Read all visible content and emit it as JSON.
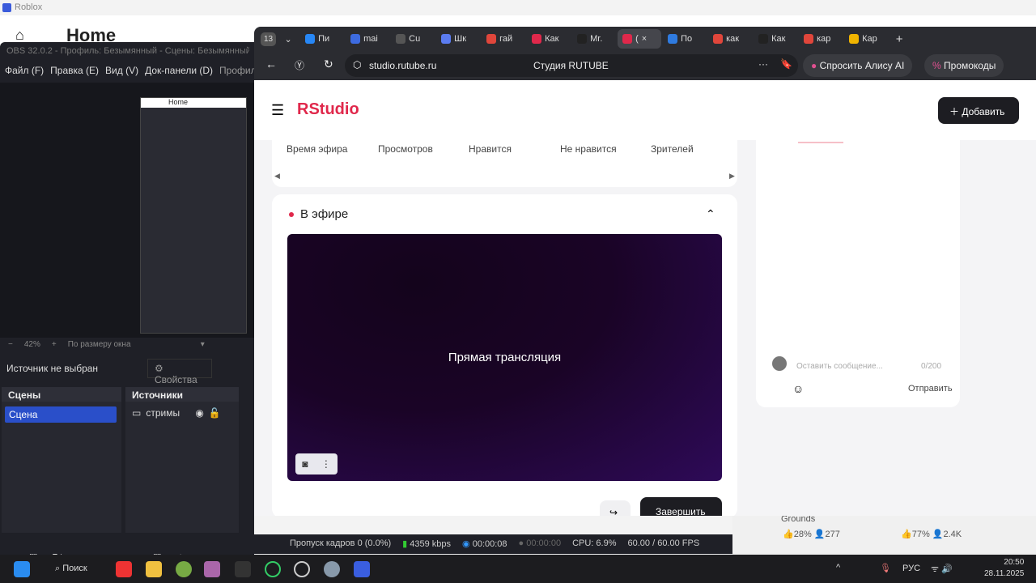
{
  "roblox": {
    "title": "Roblox",
    "home": "Home",
    "stats": [
      {
        "like": "28%",
        "players": "277"
      },
      {
        "like": "77%",
        "players": "2.4K"
      }
    ],
    "game_name": "Grounds"
  },
  "obs": {
    "title": "OBS 32.0.2 - Профиль: Безымянный - Сцены: Безымянный",
    "menu": [
      "Файл (F)",
      "Правка (E)",
      "Вид (V)",
      "Док-панели (D)",
      "Профиль"
    ],
    "mini_home": "Home",
    "zoom": "42%",
    "zoom_mode": "По размеру окна",
    "no_source": "Источник не выбран",
    "properties": "Свойства",
    "scenes_title": "Сцены",
    "scene": "Сцена",
    "sources_title": "Источники",
    "source": "стримы",
    "status": {
      "dropped": "Пропуск кадров 0 (0.0%)",
      "bitrate": "4359 kbps",
      "stream_time": "00:00:08",
      "rec_time": "00:00:00",
      "cpu": "CPU: 6.9%",
      "fps": "60.00 / 60.00 FPS"
    }
  },
  "browser": {
    "tab_count": "13",
    "tabs": [
      {
        "label": "Пи",
        "color": "#2787f5"
      },
      {
        "label": "mai",
        "color": "#3d6be0"
      },
      {
        "label": "Cu",
        "color": "#555"
      },
      {
        "label": "Шк",
        "color": "#5b7cf0"
      },
      {
        "label": "гай",
        "color": "#e0463b"
      },
      {
        "label": "Как",
        "color": "#e0284b"
      },
      {
        "label": "Mr.",
        "color": "#222"
      },
      {
        "label": "(",
        "color": "#e0284b"
      },
      {
        "label": "По",
        "color": "#2f7be0"
      },
      {
        "label": "как",
        "color": "#e0463b"
      },
      {
        "label": "Как",
        "color": "#222"
      },
      {
        "label": "кар",
        "color": "#e0463b"
      },
      {
        "label": "Кар",
        "color": "#f0b400"
      }
    ],
    "url": "studio.rutube.ru",
    "page_title": "Студия RUTUBE",
    "alice": "Спросить Алису AI",
    "promo": "Промокоды"
  },
  "studio": {
    "logo_r": "R",
    "logo_text": "Studio",
    "add": "Добавить",
    "stats_labels": [
      "Время эфира",
      "Просмотров",
      "Нравится",
      "Не нравится",
      "Зрителей"
    ],
    "live_header": "В эфире",
    "player_text": "Прямая трансляция",
    "finish": "Завершить",
    "chat": {
      "placeholder": "Оставить сообщение...",
      "counter": "0/200",
      "send": "Отправить"
    }
  },
  "taskbar": {
    "search": "Поиск",
    "lang": "РУС",
    "time": "20:50",
    "date": "28.11.2025"
  }
}
